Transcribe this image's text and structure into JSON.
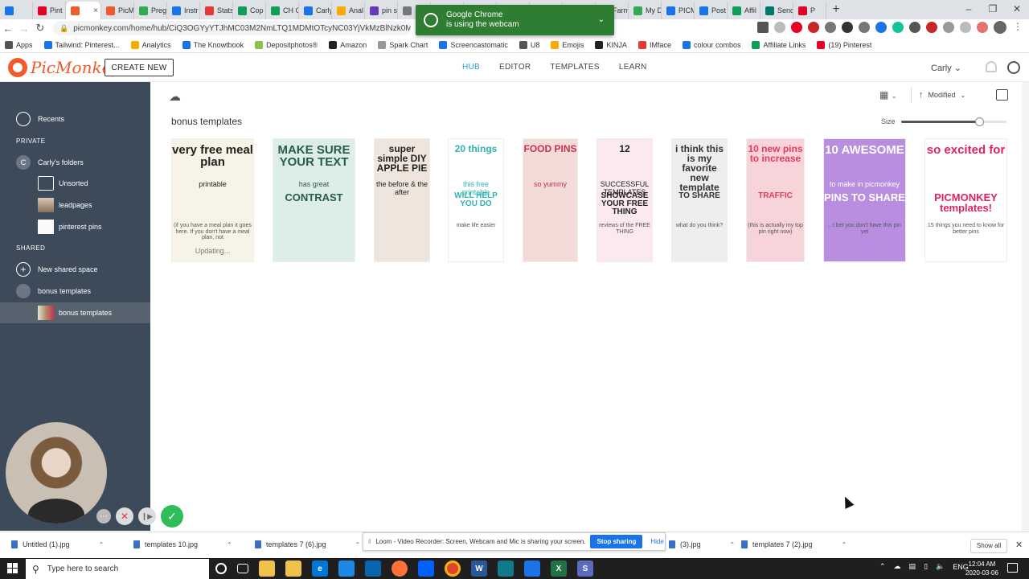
{
  "browser": {
    "tabs": [
      {
        "label": "",
        "color": "#1a73e8"
      },
      {
        "label": "Pint",
        "color": "#e60023"
      },
      {
        "label": "",
        "color": "#f15a29",
        "active": true
      },
      {
        "label": "PicM",
        "color": "#f15a29"
      },
      {
        "label": "Preg",
        "color": "#34a853"
      },
      {
        "label": "Instr",
        "color": "#1a73e8"
      },
      {
        "label": "Stats",
        "color": "#e53935"
      },
      {
        "label": "Cop",
        "color": "#0f9d58"
      },
      {
        "label": "CH C",
        "color": "#0f9d58"
      },
      {
        "label": "Carly",
        "color": "#1a73e8"
      },
      {
        "label": "Anal",
        "color": "#f9ab00"
      },
      {
        "label": "pin s",
        "color": "#673ab7"
      },
      {
        "label": "",
        "color": "#777"
      },
      {
        "label": "",
        "color": "#777"
      },
      {
        "label": "",
        "color": "#777"
      },
      {
        "label": "",
        "color": "#777"
      },
      {
        "label": "",
        "color": "#777"
      },
      {
        "label": "(20)",
        "color": "#e60023"
      },
      {
        "label": "Farm",
        "color": "#f15a29"
      },
      {
        "label": "My D",
        "color": "#34a853"
      },
      {
        "label": "PICM",
        "color": "#1a73e8"
      },
      {
        "label": "Post",
        "color": "#1a73e8"
      },
      {
        "label": "Affil",
        "color": "#0f9d58"
      },
      {
        "label": "Send",
        "color": "#00796b"
      },
      {
        "label": "P",
        "color": "#e60023"
      }
    ],
    "url": "picmonkey.com/home/hub/CiQ3OGYyYTJhMC03M2NmLTQ1MDMtOTcyNC03YjVkMzBlNzk0MTM?size=",
    "bookmarks": [
      {
        "label": "Apps",
        "color": "#555"
      },
      {
        "label": "Tailwind: Pinterest...",
        "color": "#1a73e8"
      },
      {
        "label": "Analytics",
        "color": "#f9ab00"
      },
      {
        "label": "The Knowtbook",
        "color": "#1a73e8"
      },
      {
        "label": "Depositphotos®",
        "color": "#8bc34a"
      },
      {
        "label": "Amazon",
        "color": "#222"
      },
      {
        "label": "Spark Chart",
        "color": "#999"
      },
      {
        "label": "Screencastomatic",
        "color": "#1a73e8"
      },
      {
        "label": "U8",
        "color": "#555"
      },
      {
        "label": "Emojis",
        "color": "#f9ab00"
      },
      {
        "label": "KINJA",
        "color": "#222"
      },
      {
        "label": "IMface",
        "color": "#e53935"
      },
      {
        "label": "colour combos",
        "color": "#1a73e8"
      },
      {
        "label": "Affiliate Links",
        "color": "#0f9d58"
      },
      {
        "label": "(19) Pinterest",
        "color": "#e60023"
      }
    ],
    "notification": {
      "line1": "Google Chrome",
      "line2": "is using the webcam"
    }
  },
  "header": {
    "logo": "PicMonkey",
    "create_new": "CREATE NEW",
    "nav": [
      "HUB",
      "EDITOR",
      "TEMPLATES",
      "LEARN"
    ],
    "active_nav": "HUB",
    "user": "Carly"
  },
  "sidebar": {
    "recents": "Recents",
    "private_heading": "PRIVATE",
    "user_folder": "Carly's folders",
    "user_initial": "C",
    "private_items": [
      "Unsorted",
      "leadpages",
      "pinterest pins"
    ],
    "shared_heading": "SHARED",
    "new_shared": "New shared space",
    "shared_space": "bonus templates",
    "shared_folder": "bonus templates"
  },
  "main": {
    "folder_title": "bonus templates",
    "sort_label": "Modified",
    "size_label": "Size",
    "size_value": 0.74,
    "updating": "Updating..."
  },
  "templates": [
    {
      "big": "very free meal plan",
      "mid": "printable",
      "small": "(if you have a meal plan it goes here. If you don't have a meal plan, not",
      "bg": "#f7f3e6",
      "fg": "#222"
    },
    {
      "big": "MAKE SURE YOUR TEXT",
      "mid": "has great",
      "big2": "CONTRAST",
      "bg": "#ddeee9",
      "fg": "#2b5a4a"
    },
    {
      "big": "super simple DIY APPLE PIE",
      "mid": "the before & the after",
      "bg": "#efe5dc",
      "fg": "#222"
    },
    {
      "big": "20 things",
      "mid": "this free printable",
      "big2": "WILL HELP YOU DO",
      "small": "make life easier",
      "bg": "#fff",
      "fg": "#2bb5ae"
    },
    {
      "big": "FOOD PINS",
      "mid": "so yummy",
      "bg": "#f3dcd8",
      "fg": "#c9304b"
    },
    {
      "big": "12",
      "mid": "SUCCESSFUL TEMPLATES",
      "big2": "SHOWCASE YOUR FREE THING",
      "small": "reviews of the FREE THING",
      "bg": "#fbe9ee",
      "fg": "#222"
    },
    {
      "big": "i think this is my favorite new template",
      "big2": "TO SHARE",
      "small": "what do you think?",
      "bg": "#eeeeee",
      "fg": "#333"
    },
    {
      "big": "10 new pins to increase",
      "big2": "TRAFFIC",
      "small": "(this is actually my top pin right now)",
      "bg": "#f6d4da",
      "fg": "#e83a5a"
    },
    {
      "big": "10 AWESOME",
      "big2": "PINS TO SHARE",
      "mid": "to make in picmonkey",
      "small": "...I bet you don't have this pin yet",
      "bg": "#b98ee0",
      "fg": "#fff"
    },
    {
      "big": "so excited for",
      "big2": "PICMONKEY templates!",
      "small": "15 things you need to know for better pins",
      "bg": "#fff",
      "fg": "#e0235f"
    }
  ],
  "downloads": [
    {
      "name": "Untitled (1).jpg"
    },
    {
      "name": "templates 10.jpg"
    },
    {
      "name": "templates 7 (6).jpg"
    },
    {
      "name": "(3).jpg"
    },
    {
      "name": "templates 7 (2).jpg"
    }
  ],
  "downloads_show_all": "Show all",
  "loom": {
    "message": "Loom - Video Recorder: Screen, Webcam and Mic is sharing your screen.",
    "stop": "Stop sharing",
    "hide": "Hide"
  },
  "taskbar": {
    "search_placeholder": "Type here to search",
    "lang": "ENG",
    "time": "12:04 AM",
    "date": "2020-03-06"
  }
}
